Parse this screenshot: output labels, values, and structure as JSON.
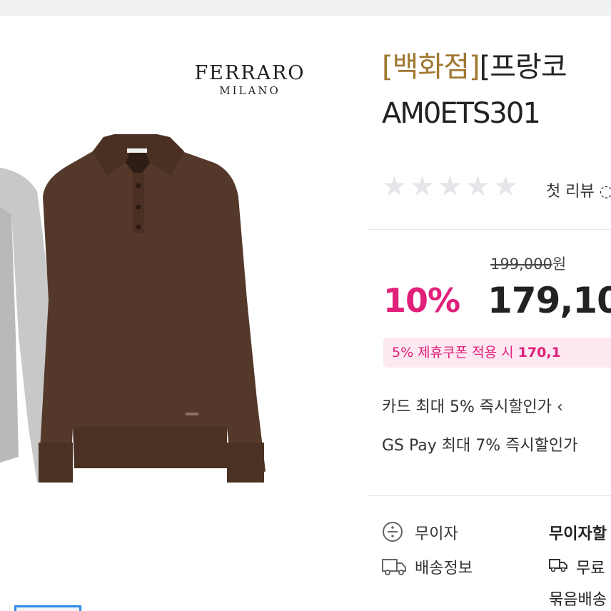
{
  "product_image": {
    "brand_name": "FERRARO",
    "brand_sub": "MILANO"
  },
  "product": {
    "title_dept": "[백화점]",
    "title_rest": "[프랑코",
    "model_code": "AM0ETS301"
  },
  "rating": {
    "stars_filled": 0,
    "stars_total": 5,
    "review_text": "첫 리뷰 ◌"
  },
  "pricing": {
    "original_price": "199,000",
    "original_unit": "원",
    "discount_rate": "10%",
    "sale_price": "179,10",
    "coupon_text": "5% 제휴쿠폰 적용 시",
    "coupon_price": "170,1"
  },
  "benefits": [
    {
      "text": "카드 최대 5% 즉시할인가 ‹"
    },
    {
      "text": "GS Pay 최대 7% 즉시할인가"
    }
  ],
  "info_rows": [
    {
      "label": "무이자",
      "value": "무이자할",
      "icon": "installment-icon"
    },
    {
      "label": "배송정보",
      "value": "무료",
      "icon": "truck-icon"
    }
  ],
  "shipping_extra": "묶음배송",
  "colors": {
    "accent_pink": "#e0207a",
    "dept_gold": "#a07830",
    "thumb_border": "#2e8be6"
  }
}
